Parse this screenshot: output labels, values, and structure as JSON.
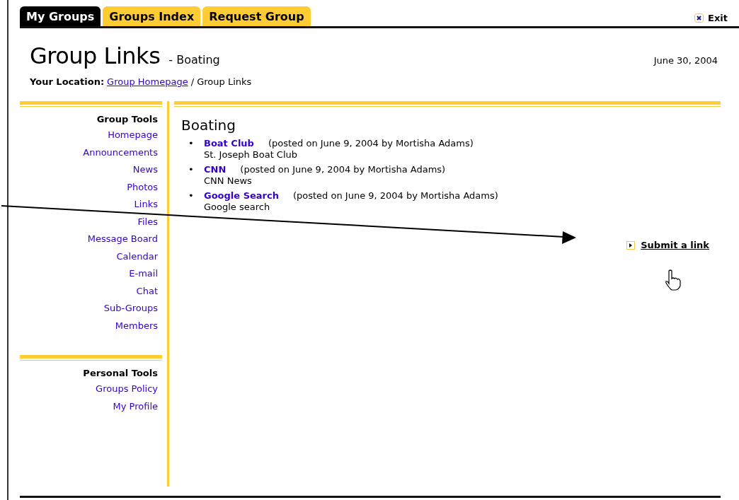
{
  "tabs": [
    {
      "label": "My Groups",
      "selected": true
    },
    {
      "label": "Groups Index",
      "selected": false
    },
    {
      "label": "Request Group",
      "selected": false
    }
  ],
  "exit": {
    "label": "Exit"
  },
  "header": {
    "title": "Group Links",
    "subtitle": "- Boating",
    "date": "June 30, 2004"
  },
  "breadcrumb": {
    "label": "Your Location:",
    "link": "Group Homepage",
    "current": "/ Group Links"
  },
  "sidebar": {
    "sections": [
      {
        "heading": "Group Tools",
        "items": [
          "Homepage",
          "Announcements",
          "News",
          "Photos",
          "Links",
          "Files",
          "Message Board",
          "Calendar",
          "E-mail",
          "Chat",
          "Sub-Groups",
          "Members"
        ]
      },
      {
        "heading": "Personal Tools",
        "items": [
          "Groups Policy",
          "My Profile"
        ]
      }
    ]
  },
  "content": {
    "heading": "Boating",
    "bullet": "•",
    "links": [
      {
        "title": "Boat Club",
        "posted": "(posted on June 9, 2004 by Mortisha Adams)",
        "description": "St. Joseph Boat Club"
      },
      {
        "title": "CNN",
        "posted": "(posted on June 9, 2004 by Mortisha Adams)",
        "description": "CNN News"
      },
      {
        "title": "Google Search",
        "posted": "(posted on June 9, 2004 by Mortisha Adams)",
        "description": "Google search"
      }
    ],
    "submit": {
      "label": "Submit a link"
    }
  }
}
